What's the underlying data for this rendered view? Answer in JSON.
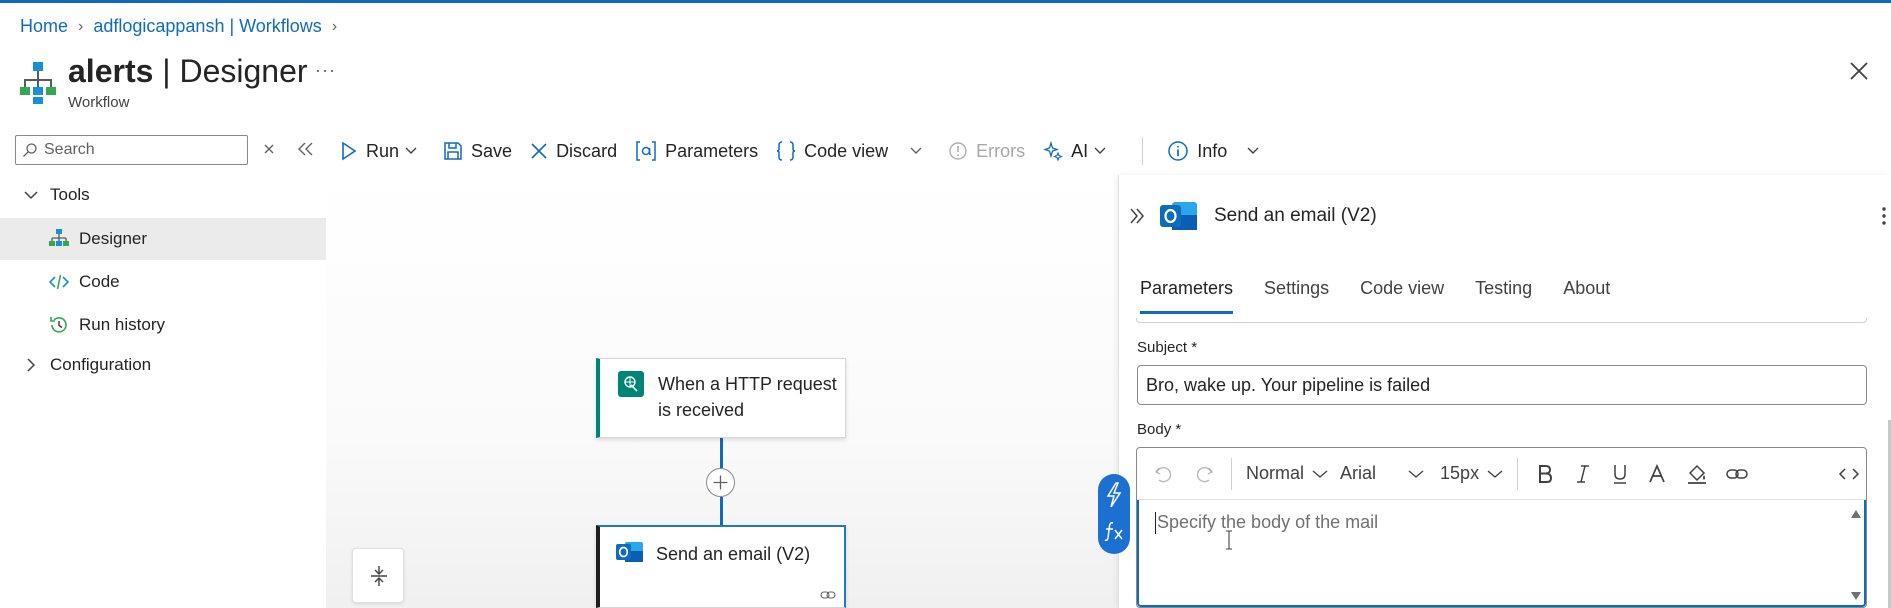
{
  "breadcrumb": {
    "home": "Home",
    "parent": "adflogicappansh | Workflows"
  },
  "header": {
    "title_bold": "alerts",
    "title_rest": " | Designer",
    "subtitle": "Workflow",
    "more": "···"
  },
  "sidebar": {
    "search_placeholder": "Search",
    "items": [
      {
        "label": "Tools",
        "icon": "chevron-down-icon"
      },
      {
        "label": "Designer",
        "icon": "designer-icon",
        "selected": true
      },
      {
        "label": "Code",
        "icon": "code-icon"
      },
      {
        "label": "Run history",
        "icon": "history-icon"
      },
      {
        "label": "Configuration",
        "icon": "chevron-right-icon"
      }
    ]
  },
  "toolbar": {
    "run": "Run",
    "save": "Save",
    "discard": "Discard",
    "parameters": "Parameters",
    "code_view": "Code view",
    "errors": "Errors",
    "ai": "AI",
    "info": "Info"
  },
  "canvas": {
    "trigger_label_line1": "When a HTTP request",
    "trigger_label_line2": "is received",
    "action_label": "Send an email (V2)"
  },
  "panel": {
    "title": "Send an email (V2)",
    "tabs": [
      "Parameters",
      "Settings",
      "Code view",
      "Testing",
      "About"
    ],
    "subject_label": "Subject *",
    "subject_value": "Bro, wake up. Your pipeline is failed",
    "body_label": "Body *",
    "editor": {
      "paragraph_style": "Normal",
      "font": "Arial",
      "size": "15px"
    },
    "body_placeholder": "Specify the body of the mail"
  },
  "colors": {
    "accent": "#0f6cbd",
    "trigger": "#008575",
    "outlook": "#0a5fb4"
  }
}
